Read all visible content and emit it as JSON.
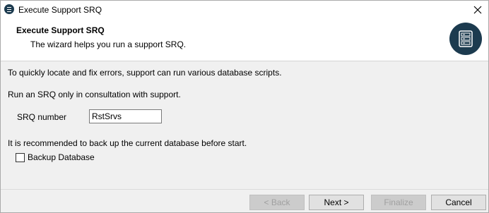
{
  "window": {
    "title": "Execute Support SRQ",
    "accent_color": "#1c3b4f"
  },
  "banner": {
    "title": "Execute Support SRQ",
    "description": "The wizard helps you run a support SRQ.",
    "icon": "database-server-icon"
  },
  "body": {
    "intro": "To quickly locate and fix errors, support can run various database scripts.",
    "warning": "Run an SRQ only in consultation with support.",
    "srq_label": "SRQ number",
    "srq_value": "RstSrvs",
    "backup_note": "It is recommended to back up the current database before start.",
    "backup_label": "Backup Database",
    "backup_checked": false
  },
  "footer": {
    "back_label": "< Back",
    "next_label": "Next >",
    "finalize_label": "Finalize",
    "cancel_label": "Cancel"
  }
}
